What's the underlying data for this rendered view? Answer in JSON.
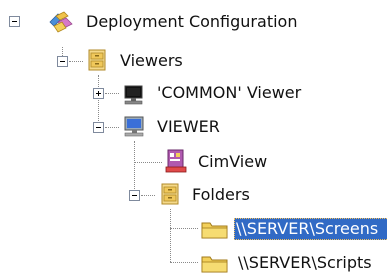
{
  "tree": {
    "root": {
      "label": "Deployment Configuration",
      "icon": "deployment-config-icon",
      "state": "expanded"
    },
    "viewers": {
      "label": "Viewers",
      "icon": "cabinet-folder-icon",
      "state": "expanded"
    },
    "common_viewer": {
      "label": "'COMMON' Viewer",
      "icon": "monitor-black-icon",
      "state": "collapsed"
    },
    "viewer": {
      "label": "VIEWER",
      "icon": "monitor-blue-icon",
      "state": "expanded"
    },
    "cimview": {
      "label": "CimView",
      "icon": "cimview-app-icon"
    },
    "folders": {
      "label": "Folders",
      "icon": "cabinet-folder-icon",
      "state": "expanded"
    },
    "folder_screens": {
      "label": "\\\\SERVER\\Screens",
      "icon": "folder-icon",
      "selected": true
    },
    "folder_scripts": {
      "label": "\\\\SERVER\\Scripts",
      "icon": "folder-icon",
      "selected": false
    }
  },
  "colors": {
    "selection": "#316ac5",
    "selection_text": "#ffffff",
    "folder_yellow": "#f3d05a",
    "monitor_blue": "#3a6fd8"
  }
}
